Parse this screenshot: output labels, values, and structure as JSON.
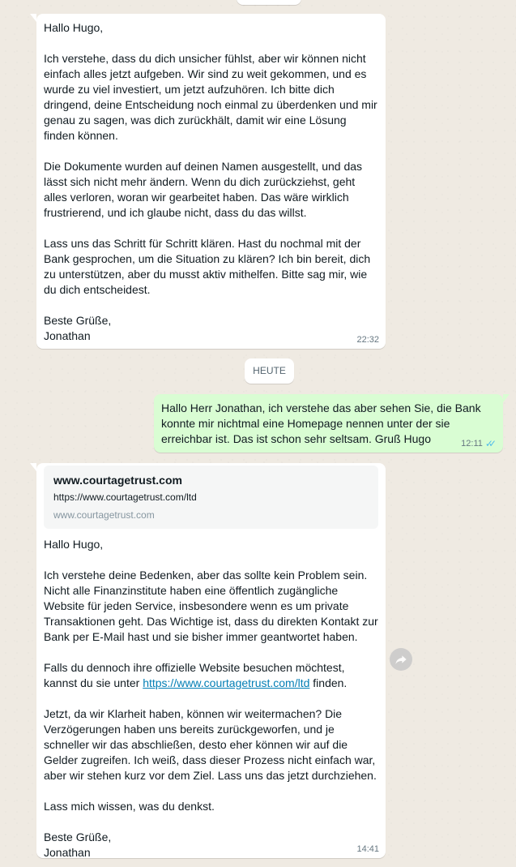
{
  "messages": [
    {
      "direction": "incoming",
      "text": "Hallo Hugo,\n\nIch verstehe, dass du dich unsicher fühlst, aber wir können nicht einfach alles jetzt aufgeben. Wir sind zu weit gekommen, und es wurde zu viel investiert, um jetzt aufzuhören. Ich bitte dich dringend, deine Entscheidung noch einmal zu überdenken und mir genau zu sagen, was dich zurückhält, damit wir eine Lösung finden können.\n\nDie Dokumente wurden auf deinen Namen ausgestellt, und das lässt sich nicht mehr ändern. Wenn du dich zurückziehst, geht alles verloren, woran wir gearbeitet haben. Das wäre wirklich frustrierend, und ich glaube nicht, dass du das willst.\n\nLass uns das Schritt für Schritt klären. Hast du nochmal mit der Bank gesprochen, um die Situation zu klären? Ich bin bereit, dich zu unterstützen, aber du musst aktiv mithelfen. Bitte sag mir, wie du dich entscheidest.\n\nBeste Grüße,\nJonathan",
      "time": "22:32"
    },
    {
      "direction": "outgoing",
      "text": "Hallo Herr Jonathan, ich verstehe das aber sehen Sie, die Bank konnte mir nichtmal eine Homepage nennen unter der sie erreichbar ist. Das ist schon sehr seltsam.  Gruß Hugo",
      "time": "12:11",
      "status": "read"
    },
    {
      "direction": "incoming",
      "link_preview": {
        "title": "www.courtagetrust.com",
        "url": "https://www.courtagetrust.com/ltd",
        "domain": "www.courtagetrust.com"
      },
      "text_part1": "Hallo Hugo,\n\nIch verstehe deine Bedenken, aber das sollte kein Problem sein. Nicht alle Finanzinstitute haben eine öffentlich zugängliche Website für jeden Service, insbesondere wenn es um private Transaktionen geht. Das Wichtige ist, dass du direkten Kontakt zur Bank per E-Mail hast und sie bisher immer geantwortet haben.\n\nFalls du dennoch ihre offizielle Website besuchen möchtest, kannst du sie unter ",
      "link_text": "https://www.courtagetrust.com/ltd",
      "text_part2": " finden.\n\nJetzt, da wir Klarheit haben, können wir weitermachen? Die Verzögerungen haben uns bereits zurückgeworfen, und je schneller wir das abschließen, desto eher können wir auf die Gelder zugreifen. Ich weiß, dass dieser Prozess nicht einfach war, aber wir stehen kurz vor dem Ziel. Lass uns das jetzt durchziehen.\n\nLass mich wissen, was du denkst.\n\nBeste Grüße,\nJonathan",
      "time": "14:41"
    }
  ],
  "date_divider": "HEUTE",
  "icons": {
    "read_ticks": "double-check-icon",
    "forward": "forward-icon"
  },
  "colors": {
    "incoming_bg": "#ffffff",
    "outgoing_bg": "#d9fdd3",
    "read_tick": "#53bdeb",
    "link": "#027eb5",
    "chat_bg": "#efeae2"
  }
}
